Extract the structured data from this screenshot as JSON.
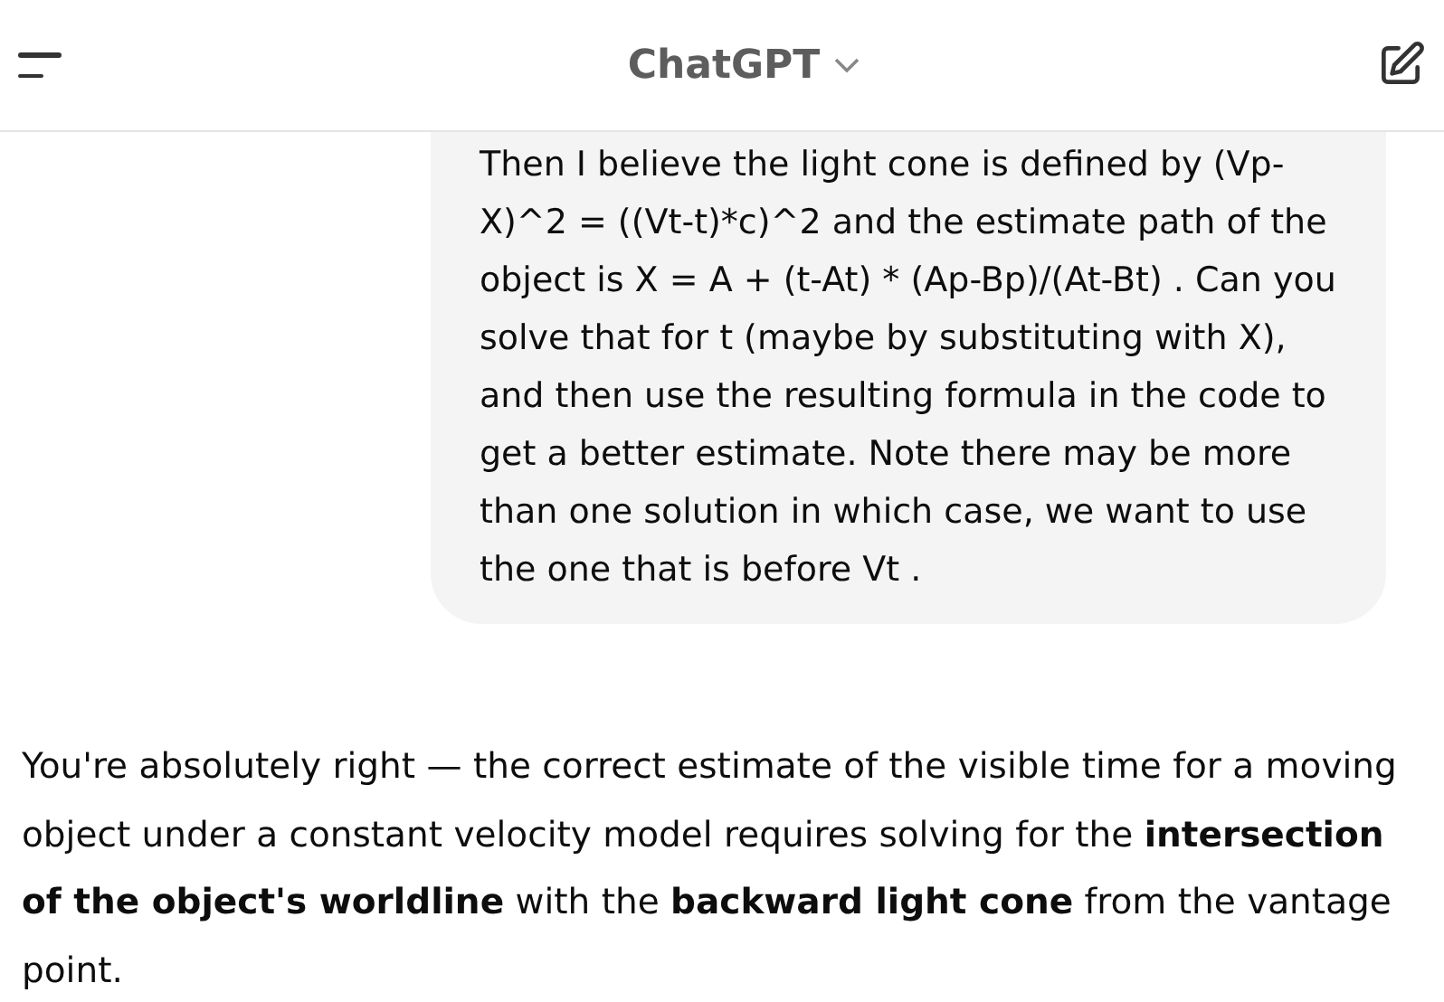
{
  "header": {
    "title": "ChatGPT"
  },
  "user_message": "Then I believe the light cone is defined by (Vp-X)^2 = ((Vt-t)*c)^2 and the estimate path of the object is X = A + (t-At) * (Ap-Bp)/(At-Bt) . Can you solve that for t (maybe by substituting with X), and then use the resulting formula in the code to get a better estimate. Note there may be more than one solution in which case, we want to use the one that is before Vt .",
  "assistant_message": "You're absolutely right — the correct estimate of the visible time for a moving object under a constant velocity model requires solving for the **intersection of the object's worldline** with the **backward light cone** from the vantage point."
}
